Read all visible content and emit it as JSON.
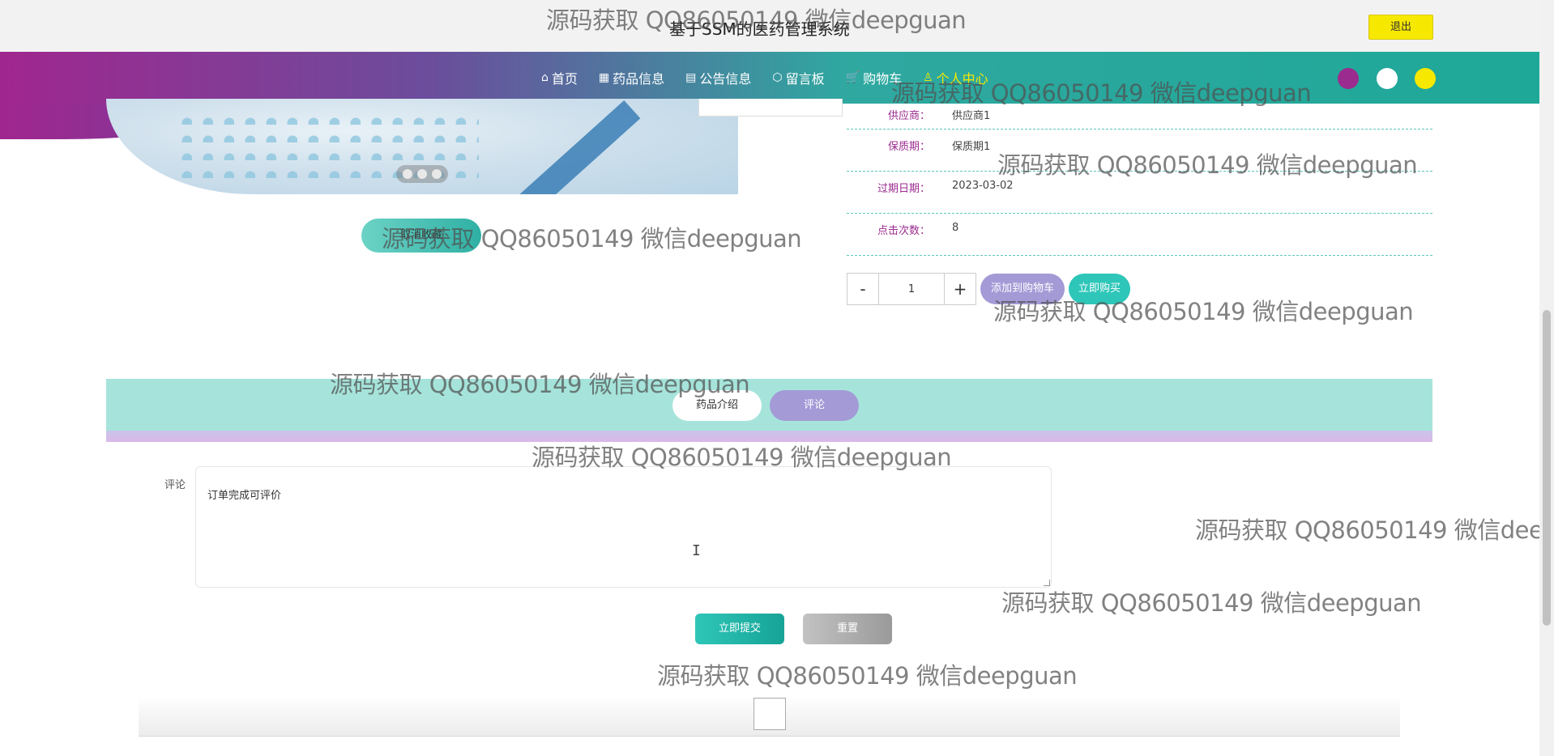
{
  "header": {
    "site_title": "基于SSM的医药管理系统",
    "logout_label": "退出"
  },
  "nav": {
    "items": [
      {
        "icon": "home-icon",
        "glyph": "⌂",
        "label": "首页"
      },
      {
        "icon": "grid-icon",
        "glyph": "▦",
        "label": "药品信息"
      },
      {
        "icon": "calendar-icon",
        "glyph": "▤",
        "label": "公告信息"
      },
      {
        "icon": "cube-icon",
        "glyph": "⬡",
        "label": "留言板"
      },
      {
        "icon": "cart-icon",
        "glyph": "🛒",
        "label": "购物车"
      },
      {
        "icon": "user-icon",
        "glyph": "♙",
        "label": "个人中心"
      }
    ],
    "active_item": "个人中心",
    "theme_colors": [
      "#9b2b8f",
      "#ffffff",
      "#f7e800"
    ]
  },
  "product": {
    "collect_label": "取消收藏",
    "details": [
      {
        "key": "供应商：",
        "value": "供应商1"
      },
      {
        "key": "保质期：",
        "value": "保质期1"
      },
      {
        "key": "过期日期：",
        "value": "2023-03-02"
      },
      {
        "key": "点击次数：",
        "value": "8"
      }
    ],
    "quantity": "1",
    "minus_label": "-",
    "plus_label": "+",
    "add_cart_label": "添加到购物车",
    "buy_now_label": "立即购买"
  },
  "tabs": {
    "intro_label": "药品介绍",
    "comment_label": "评论"
  },
  "comment_form": {
    "label": "评论",
    "value": "订单完成可评价",
    "submit_label": "立即提交",
    "reset_label": "重置"
  },
  "watermark": {
    "text": "源码获取 QQ86050149 微信deepguan"
  },
  "colors": {
    "accent_teal": "#2ec6b8",
    "accent_purple": "#a39ad6",
    "brand_magenta": "#9b2b8f",
    "highlight_yellow": "#f7e800"
  }
}
